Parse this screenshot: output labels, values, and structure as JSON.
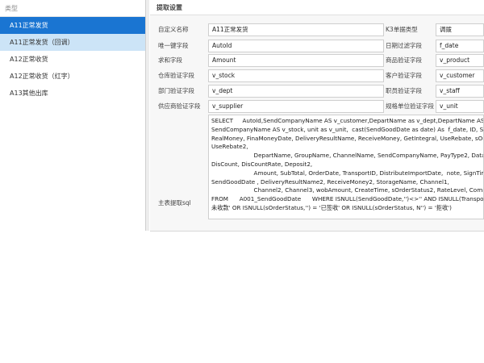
{
  "sidebar": {
    "header": "类型",
    "items": [
      {
        "label": "A11正常发货"
      },
      {
        "label": "A11正常发货（回调）"
      },
      {
        "label": "A12正常收货"
      },
      {
        "label": "A12正常收货（红字）"
      },
      {
        "label": "A13其他出库"
      }
    ]
  },
  "main": {
    "title": "提取设置",
    "fields": {
      "custom_name": {
        "label": "自定义名称",
        "value": "A11正常发货"
      },
      "k3_type": {
        "label": "K3单据类型",
        "value": "调拨"
      },
      "unique_key": {
        "label": "唯一键字段",
        "value": "AutoId"
      },
      "date_filter": {
        "label": "日期过滤字段",
        "value": "f_date"
      },
      "sum_field": {
        "label": "求和字段",
        "value": "Amount"
      },
      "product_field": {
        "label": "商品验证字段",
        "value": "v_product"
      },
      "stock_field": {
        "label": "仓库验证字段",
        "value": "v_stock"
      },
      "customer_field": {
        "label": "客户验证字段",
        "value": "v_customer"
      },
      "dept_field": {
        "label": "部门验证字段",
        "value": "v_dept"
      },
      "staff_field": {
        "label": "职员验证字段",
        "value": "v_staff"
      },
      "supplier_field": {
        "label": "供应商验证字段",
        "value": "v_supplier"
      },
      "unit_field": {
        "label": "规格单位验证字段",
        "value": "v_unit"
      }
    },
    "sql_label": "主表提取sql",
    "sql": "SELECT     AutoId,SendCompanyName AS v_customer,DepartName as v_dept,DepartName AS v_staff,\nSendCompanyName AS v_stock, unit as v_unit,  cast(SendGoodDate as date) As  f_date, ID, SaleID, Pr\nRealMoney, FinaMoneyDate, DeliveryResultName, ReceiveMoney, GetIntegral, UseRebate, sOrderSta\nUseRebate2,\n                       DepartName, GroupName, ChannelName, SendCompanyName, PayType2, DataClassifi\nDisCount, DisCountRate, Deposit2,\n                       Amount, SubTotal, OrderDate, TransportID, DistributeImportDate,  note, SignTime, Re\nSendGoodDate , DeliveryResultName2, ReceiveMoney2, StorageName, Channel1,\n                       Channel2, Channel3, wobAmount, CreateTime, sOrderStatus2, RateLevel, CommissionT\nFROM      A001_SendGoodDate      WHERE ISNULL(SendGoodDate,'')<>'' AND ISNULL(TransportID,'')<\n未收款' OR ISNULL(sOrderStatus,'') = '已签收' OR ISNULL(sOrderStatus, N'') = '拒收')"
  }
}
